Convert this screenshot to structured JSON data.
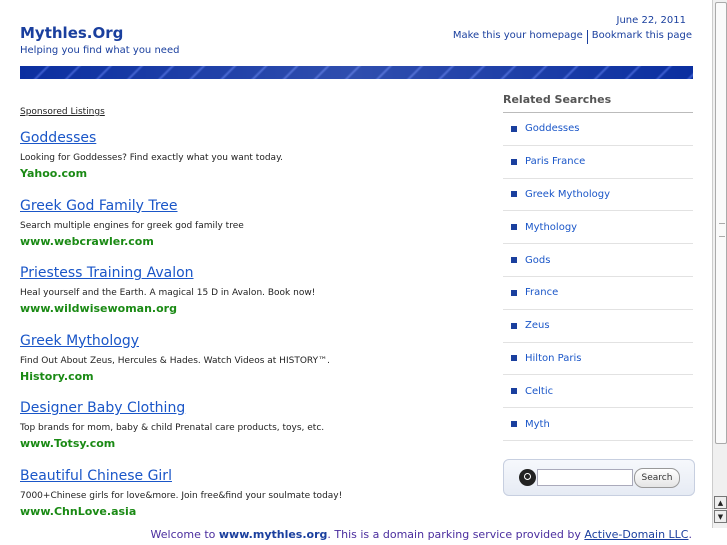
{
  "header": {
    "site_title": "Mythles.Org",
    "tagline": "Helping you find what you need",
    "date": "June 22, 2011",
    "make_homepage": "Make this your homepage",
    "bookmark": "Bookmark this page"
  },
  "sponsored_label": "Sponsored Listings",
  "listings": [
    {
      "title": "Goddesses",
      "desc": "Looking for Goddesses? Find exactly what you want today.",
      "url": "Yahoo.com"
    },
    {
      "title": "Greek God Family Tree",
      "desc": "Search multiple engines for greek god family tree",
      "url": "www.webcrawler.com"
    },
    {
      "title": "Priestess Training Avalon",
      "desc": "Heal yourself and the Earth. A magical 15 D in Avalon. Book now!",
      "url": "www.wildwisewoman.org"
    },
    {
      "title": "Greek Mythology",
      "desc": "Find Out About Zeus, Hercules & Hades. Watch Videos at HISTORY™.",
      "url": "History.com"
    },
    {
      "title": "Designer Baby Clothing",
      "desc": "Top brands for mom, baby & child Prenatal care products, toys, etc.",
      "url": "www.Totsy.com"
    },
    {
      "title": "Beautiful Chinese Girl",
      "desc": "7000+Chinese girls for love&more. Join free&find your soulmate today!",
      "url": "www.ChnLove.asia"
    }
  ],
  "related": {
    "title": "Related Searches",
    "items": [
      "Goddesses",
      "Paris France",
      "Greek Mythology",
      "Mythology",
      "Gods",
      "France",
      "Zeus",
      "Hilton Paris",
      "Celtic",
      "Myth"
    ]
  },
  "search": {
    "button": "Search",
    "value": ""
  },
  "footer": {
    "prefix": "Welcome to ",
    "domain": "www.mythles.org",
    "middle": ". This is a domain parking service provided by ",
    "provider": "Active-Domain LLC",
    "suffix": "."
  }
}
